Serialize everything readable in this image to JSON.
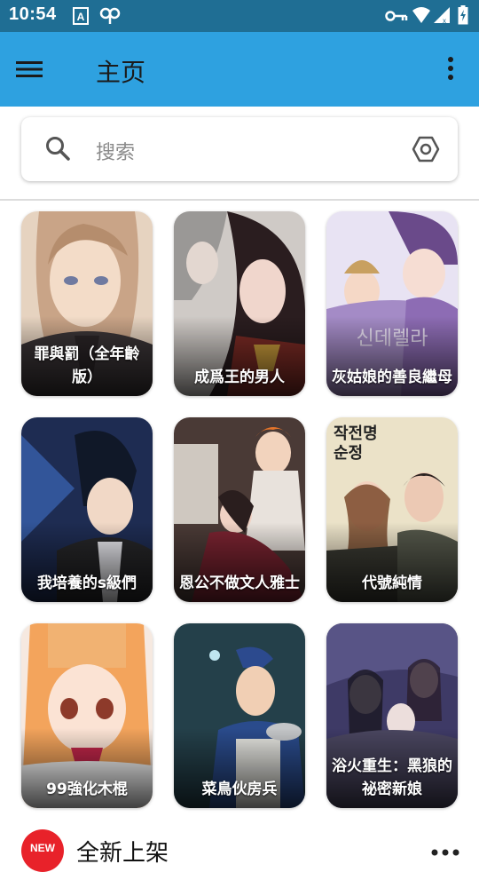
{
  "status_bar": {
    "time": "10:54",
    "icons": [
      "notification-a-icon",
      "link-icon",
      "vpn-key-icon",
      "wifi-icon",
      "signal-icon",
      "battery-icon"
    ]
  },
  "app_bar": {
    "title": "主页",
    "menu_icon": "hamburger-menu-icon",
    "overflow_icon": "more-vertical-icon"
  },
  "search": {
    "placeholder": "搜索",
    "search_icon": "search-icon",
    "filter_icon": "hexagon-settings-icon"
  },
  "comics": [
    {
      "title": "罪與罰（全年齡版）",
      "line1": "罪與罰（全年齡",
      "line2": "版）"
    },
    {
      "title": "成爲王的男人",
      "line1": "成爲王的男人",
      "line2": ""
    },
    {
      "title": "灰姑娘的善良繼母",
      "line1": "灰姑娘的善良繼母",
      "line2": ""
    },
    {
      "title": "我培養的s級們",
      "line1": "我培養的s級們",
      "line2": ""
    },
    {
      "title": "恩公不做文人雅士",
      "line1": "恩公不做文人雅士",
      "line2": ""
    },
    {
      "title": "代號純情",
      "line1": "代號純情",
      "line2": ""
    },
    {
      "title": "99強化木棍",
      "line1": "99強化木棍",
      "line2": ""
    },
    {
      "title": "菜鳥伙房兵",
      "line1": "菜鳥伙房兵",
      "line2": ""
    },
    {
      "title": "浴火重生：黑狼的祕密新娘",
      "line1": "浴火重生：黑狼的",
      "line2": "祕密新娘"
    }
  ],
  "new_section": {
    "badge": "NEW",
    "title": "全新上架",
    "more_icon": "more-horizontal-icon"
  },
  "colors": {
    "status_bar": "#1f6e94",
    "app_bar": "#2ea1e0",
    "badge": "#e8222a"
  }
}
